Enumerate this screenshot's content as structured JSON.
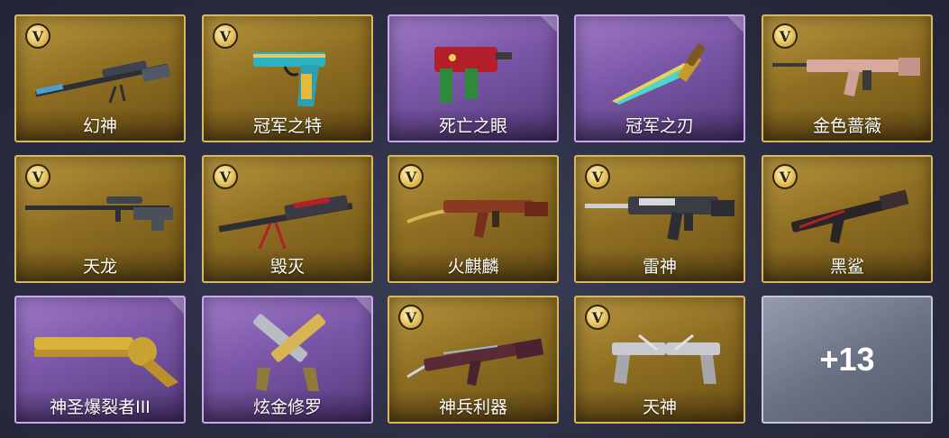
{
  "items": [
    {
      "name": "幻神",
      "rarity": "gold",
      "v_badge": "V",
      "weapon_icon": "sniper-rifle-icon"
    },
    {
      "name": "冠军之特",
      "rarity": "gold",
      "v_badge": "V",
      "weapon_icon": "pistol-icon"
    },
    {
      "name": "死亡之眼",
      "rarity": "purple",
      "v_badge": "",
      "weapon_icon": "smg-icon"
    },
    {
      "name": "冠军之刃",
      "rarity": "purple",
      "v_badge": "",
      "weapon_icon": "knife-icon"
    },
    {
      "name": "金色蔷薇",
      "rarity": "gold",
      "v_badge": "V",
      "weapon_icon": "assault-rifle-icon"
    },
    {
      "name": "天龙",
      "rarity": "gold",
      "v_badge": "V",
      "weapon_icon": "sniper-rifle-icon"
    },
    {
      "name": "毁灭",
      "rarity": "gold",
      "v_badge": "V",
      "weapon_icon": "heavy-sniper-icon"
    },
    {
      "name": "火麒麟",
      "rarity": "gold",
      "v_badge": "V",
      "weapon_icon": "ak-rifle-icon"
    },
    {
      "name": "雷神",
      "rarity": "gold",
      "v_badge": "V",
      "weapon_icon": "m4-rifle-icon"
    },
    {
      "name": "黑鲨",
      "rarity": "gold",
      "v_badge": "V",
      "weapon_icon": "ak-rifle-icon"
    },
    {
      "name": "神圣爆裂者III",
      "rarity": "purple",
      "v_badge": "",
      "weapon_icon": "shotgun-icon"
    },
    {
      "name": "炫金修罗",
      "rarity": "purple",
      "v_badge": "",
      "weapon_icon": "dual-pistol-icon"
    },
    {
      "name": "神兵利器",
      "rarity": "gold",
      "v_badge": "V",
      "weapon_icon": "ak-rifle-icon"
    },
    {
      "name": "天神",
      "rarity": "gold",
      "v_badge": "V",
      "weapon_icon": "dual-pistol-icon"
    }
  ],
  "more_button": {
    "label": "+13"
  },
  "colors": {
    "gold": "#b8963f",
    "purple": "#a07ac9",
    "silver": "#8c93a6"
  }
}
